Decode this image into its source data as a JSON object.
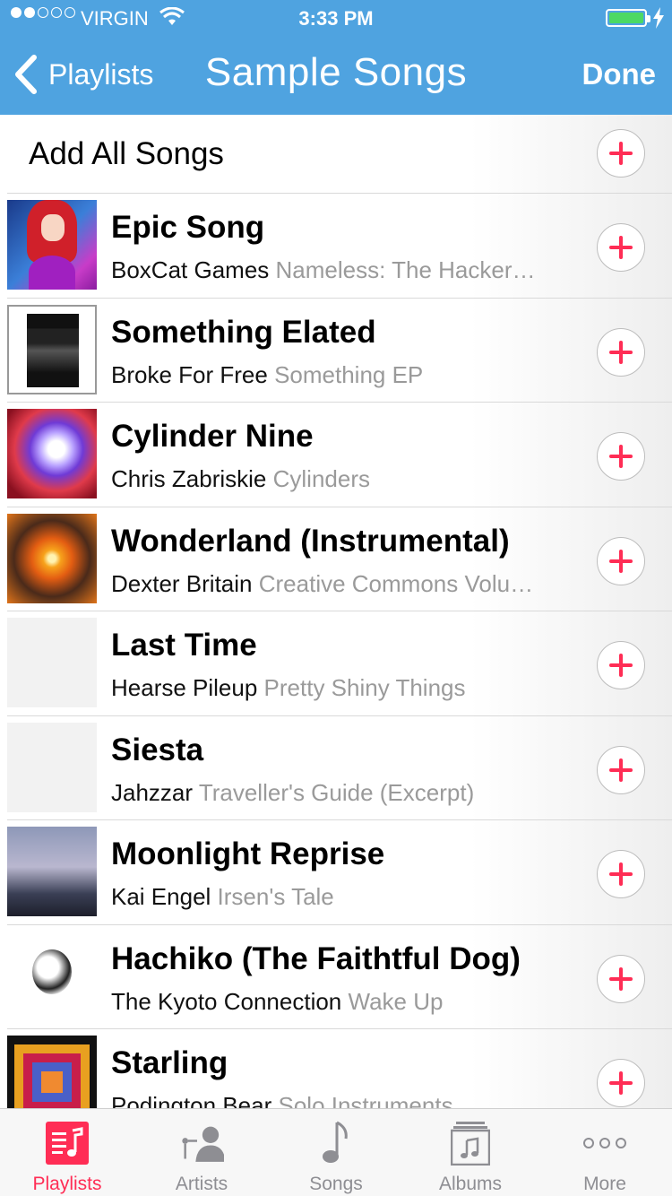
{
  "status_bar": {
    "carrier": "VIRGIN",
    "time": "3:33 PM"
  },
  "nav": {
    "back_label": "Playlists",
    "title": "Sample Songs",
    "done_label": "Done"
  },
  "add_all": {
    "label": "Add All Songs"
  },
  "songs": [
    {
      "title": "Epic Song",
      "artist": "BoxCat Games",
      "album": "Nameless: The Hacker…"
    },
    {
      "title": "Something Elated",
      "artist": "Broke For Free",
      "album": "Something EP"
    },
    {
      "title": "Cylinder Nine",
      "artist": "Chris Zabriskie",
      "album": "Cylinders"
    },
    {
      "title": "Wonderland (Instrumental)",
      "artist": "Dexter Britain",
      "album": "Creative Commons Volu…"
    },
    {
      "title": "Last Time",
      "artist": "Hearse Pileup",
      "album": "Pretty Shiny Things"
    },
    {
      "title": "Siesta",
      "artist": "Jahzzar",
      "album": "Traveller's Guide (Excerpt)"
    },
    {
      "title": "Moonlight Reprise",
      "artist": "Kai Engel",
      "album": "Irsen's Tale"
    },
    {
      "title": "Hachiko (The Faithtful Dog)",
      "artist": "The Kyoto Connection",
      "album": "Wake Up"
    },
    {
      "title": "Starling",
      "artist": "Podington Bear",
      "album": "Solo Instruments"
    }
  ],
  "tabs": [
    {
      "label": "Playlists",
      "icon": "playlists-icon"
    },
    {
      "label": "Artists",
      "icon": "artists-icon"
    },
    {
      "label": "Songs",
      "icon": "songs-icon"
    },
    {
      "label": "Albums",
      "icon": "albums-icon"
    },
    {
      "label": "More",
      "icon": "more-icon"
    }
  ],
  "active_tab": "Playlists",
  "colors": {
    "nav_background": "#4fa3e0",
    "accent": "#ff2d55",
    "battery": "#4cd964"
  }
}
